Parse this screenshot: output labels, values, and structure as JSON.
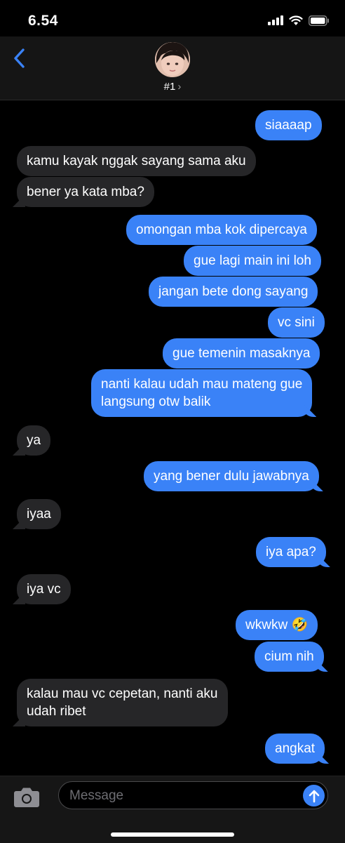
{
  "status": {
    "time": "6.54"
  },
  "header": {
    "contact": "#1",
    "chevron": "›"
  },
  "messages": [
    {
      "from": "me",
      "text": "siaaaap"
    },
    {
      "from": "them",
      "text": "kamu kayak nggak sayang sama aku"
    },
    {
      "from": "them",
      "text": "bener ya kata mba?"
    },
    {
      "from": "me",
      "text": "omongan mba kok dipercaya"
    },
    {
      "from": "me",
      "text": "gue lagi main ini loh"
    },
    {
      "from": "me",
      "text": "jangan bete dong sayang"
    },
    {
      "from": "me",
      "text": "vc sini"
    },
    {
      "from": "me",
      "text": "gue temenin masaknya"
    },
    {
      "from": "me",
      "line1": "nanti kalau udah mau mateng gue",
      "line2": "langsung otw balik"
    },
    {
      "from": "them",
      "text": "ya"
    },
    {
      "from": "me",
      "text": "yang bener dulu jawabnya"
    },
    {
      "from": "them",
      "text": "iyaa"
    },
    {
      "from": "me",
      "text": "iya apa?"
    },
    {
      "from": "them",
      "text": "iya vc"
    },
    {
      "from": "me",
      "text": "wkwkw",
      "emoji": "🤣"
    },
    {
      "from": "me",
      "text": "cium nih"
    },
    {
      "from": "them",
      "line1": "kalau mau vc cepetan, nanti aku",
      "line2": "udah ribet"
    },
    {
      "from": "me",
      "text": "angkat"
    }
  ],
  "composer": {
    "placeholder": "Message"
  },
  "icons": {
    "back": "chevron-left-icon",
    "camera": "camera-icon",
    "send": "arrow-up-icon",
    "signal": "signal-icon",
    "wifi": "wifi-icon",
    "battery": "battery-icon"
  },
  "colors": {
    "outgoing": "#3a82f7",
    "incoming": "#262628",
    "background": "#000000"
  }
}
